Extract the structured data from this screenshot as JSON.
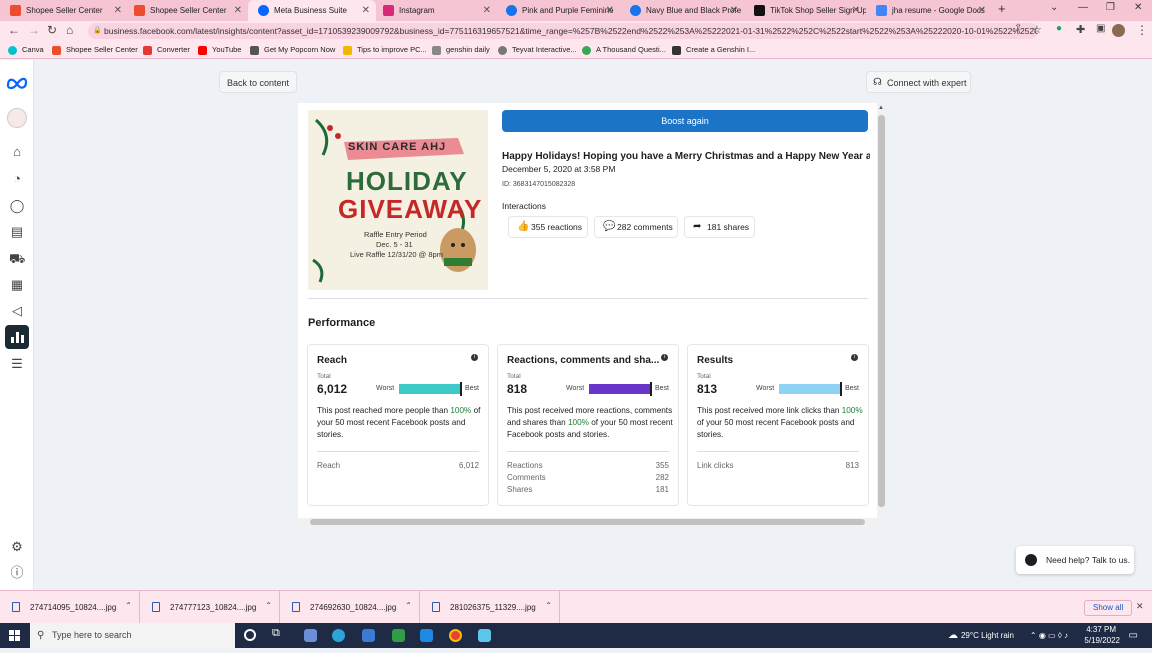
{
  "browser": {
    "tabs": [
      {
        "title": "Shopee Seller Center",
        "icon_color": "#ee4d2d"
      },
      {
        "title": "Shopee Seller Center",
        "icon_color": "#ee4d2d"
      },
      {
        "title": "Meta Business Suite",
        "icon_color": "#0866ff"
      },
      {
        "title": "Instagram",
        "icon_color": "#d62976"
      },
      {
        "title": "Pink and Purple Feminine",
        "icon_color": "#1a73e8"
      },
      {
        "title": "Navy Blue and Black Profe",
        "icon_color": "#1a73e8"
      },
      {
        "title": "TikTok Shop Seller Sign Up",
        "icon_color": "#111111"
      },
      {
        "title": "jha resume - Google Docs",
        "icon_color": "#4285f4"
      }
    ],
    "url": "business.facebook.com/latest/insights/content?asset_id=1710539239009792&business_id=775116319657521&time_range=%257B%2522end%2522%253A%25222021-01-31%2522%252C%2522start%2522%253A%25222020-10-01%2522%252C%2522%25...",
    "bookmarks": [
      {
        "label": "Canva",
        "color": "#00c4cc"
      },
      {
        "label": "Shopee Seller Center",
        "color": "#ee4d2d"
      },
      {
        "label": "Converter",
        "color": "#e53935"
      },
      {
        "label": "YouTube",
        "color": "#ff0000"
      },
      {
        "label": "Get My Popcorn Now",
        "color": "#555555"
      },
      {
        "label": "Tips to improve PC...",
        "color": "#f4b400"
      },
      {
        "label": "genshin daily",
        "color": "#888888"
      },
      {
        "label": "Teyvat Interactive...",
        "color": "#777777"
      },
      {
        "label": "A Thousand Questi...",
        "color": "#34a853"
      },
      {
        "label": "Create a Genshin I...",
        "color": "#333333"
      }
    ]
  },
  "header": {
    "back_label": "Back to content",
    "connect_label": "Connect with expert"
  },
  "post": {
    "boost_label": "Boost again",
    "title": "Happy Holidays! Hoping you have a Merry Christmas and a Happy New Year a...",
    "date": "December 5, 2020 at 3:58 PM",
    "id": "ID: 3683147015082328",
    "interactions_label": "Interactions",
    "reactions": "355 reactions",
    "comments": "282 comments",
    "shares": "181 shares",
    "image": {
      "brand": "SKIN CARE AHJ",
      "line1": "HOLIDAY",
      "line2": "GIVEAWAY",
      "raffle1": "Raffle Entry Period",
      "raffle2": "Dec. 5 - 31",
      "raffle3": "Live Raffle 12/31/20 @ 8pm"
    }
  },
  "performance": {
    "title": "Performance",
    "cards": [
      {
        "title": "Reach",
        "total_label": "Total",
        "total": "6,012",
        "worst": "Worst",
        "best": "Best",
        "bar_color": "#3ec9c9",
        "bar_level": 1.0,
        "desc_a": "This post reached more people than ",
        "desc_pct": "100%",
        "desc_b": " of your 50 most recent Facebook posts and stories.",
        "rows": [
          {
            "label": "Reach",
            "value": "6,012"
          }
        ]
      },
      {
        "title": "Reactions, comments and sha...",
        "total_label": "Total",
        "total": "818",
        "worst": "Worst",
        "best": "Best",
        "bar_color": "#6a35c9",
        "bar_level": 1.0,
        "desc_a": "This post received more reactions, comments and shares than ",
        "desc_pct": "100%",
        "desc_b": " of your 50 most recent Facebook posts and stories.",
        "rows": [
          {
            "label": "Reactions",
            "value": "355"
          },
          {
            "label": "Comments",
            "value": "282"
          },
          {
            "label": "Shares",
            "value": "181"
          }
        ]
      },
      {
        "title": "Results",
        "total_label": "Total",
        "total": "813",
        "worst": "Worst",
        "best": "Best",
        "bar_color": "#8fd3f4",
        "bar_level": 1.0,
        "desc_a": "This post received more link clicks than ",
        "desc_pct": "100%",
        "desc_b": " of your 50 most recent Facebook posts and stories.",
        "rows": [
          {
            "label": "Link clicks",
            "value": "813"
          }
        ]
      }
    ]
  },
  "help": {
    "label": "Need help? Talk to us."
  },
  "downloads": {
    "items": [
      "274714095_10824....jpg",
      "274777123_10824....jpg",
      "274692630_10824....jpg",
      "281026375_11329....jpg"
    ],
    "show_all": "Show all"
  },
  "taskbar": {
    "search_placeholder": "Type here to search",
    "weather": "29°C  Light rain",
    "time": "4:37 PM",
    "date": "5/19/2022"
  }
}
